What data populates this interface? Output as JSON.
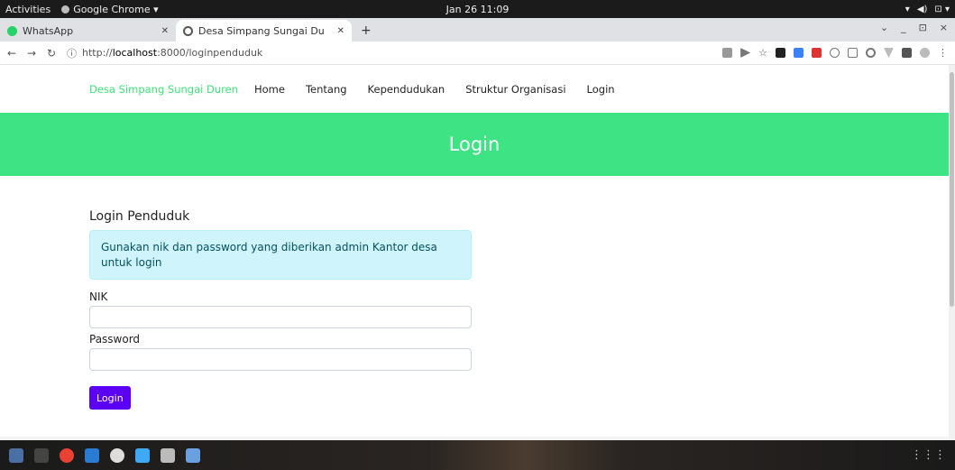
{
  "system": {
    "activities": "Activities",
    "app_name": "Google Chrome ▾",
    "clock": "Jan 26  11:09",
    "tray": [
      "▾",
      "◀)",
      "⊡ ▾"
    ]
  },
  "browser": {
    "tabs": [
      {
        "title": "WhatsApp",
        "icon": "whatsapp-icon"
      },
      {
        "title": "Desa Simpang Sungai Du",
        "icon": "site-icon",
        "active": true
      }
    ],
    "new_tab": "+",
    "url_prefix": "http://",
    "url_host": "localhost",
    "url_path": ":8000/loginpenduduk",
    "window_controls": [
      "⌄",
      "_",
      "⊡",
      "×"
    ]
  },
  "site": {
    "brand": "Desa Simpang Sungai Duren",
    "nav": [
      "Home",
      "Tentang",
      "Kependudukan",
      "Struktur Organisasi",
      "Login"
    ],
    "hero_title": "Login",
    "section_title": "Login Penduduk",
    "alert_text": "Gunakan nik dan password yang diberikan admin Kantor desa untuk login",
    "nik_label": "NIK",
    "nik_value": "",
    "password_label": "Password",
    "password_value": "",
    "submit_label": "Login"
  },
  "colors": {
    "accent_green": "#3ee384",
    "button_purple": "#5c00f5",
    "alert_bg": "#cff4fc"
  }
}
